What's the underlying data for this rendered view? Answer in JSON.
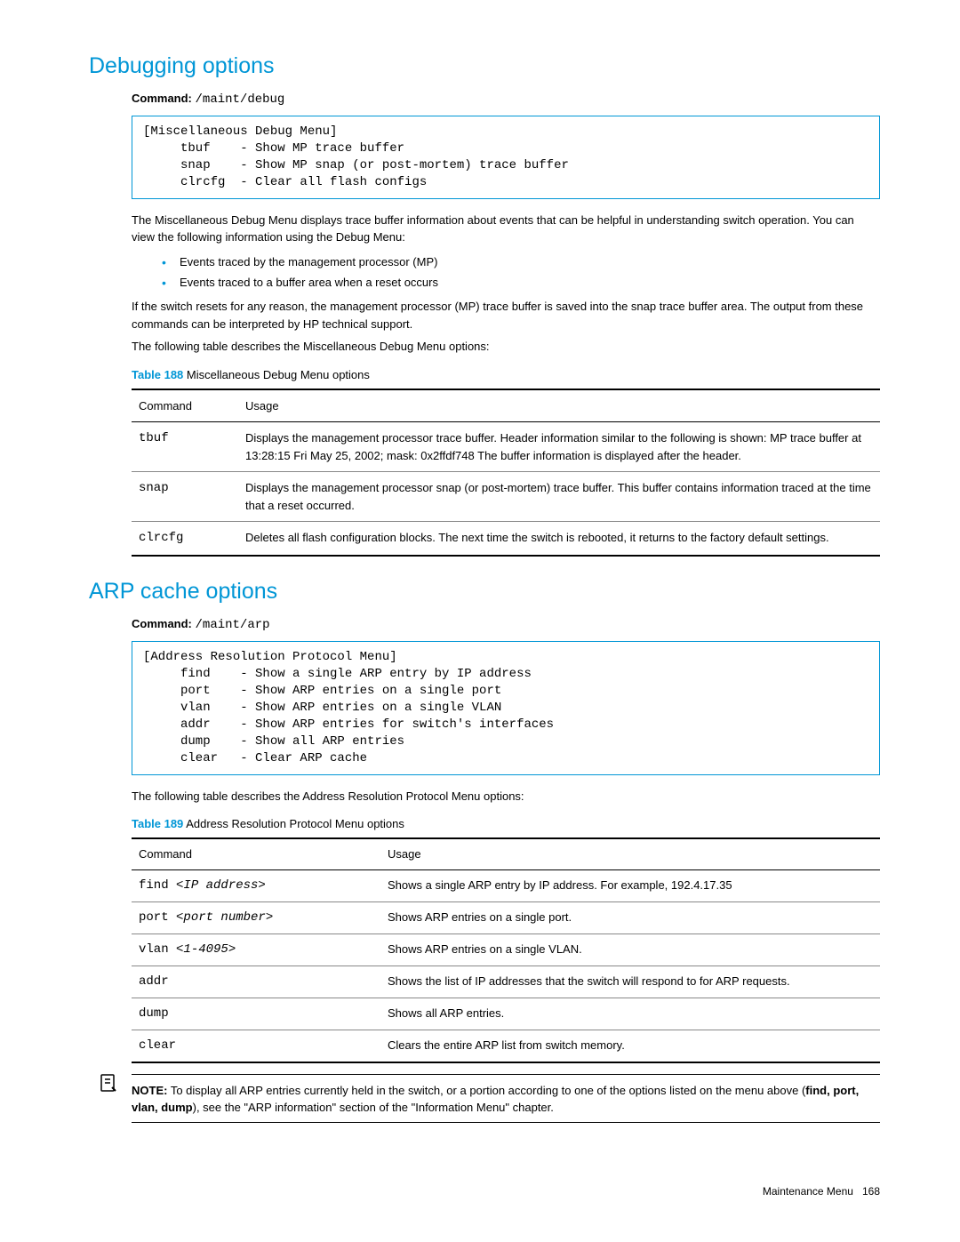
{
  "section1": {
    "heading": "Debugging options",
    "commandLabel": "Command:",
    "commandPath": "/maint/debug",
    "codebox": "[Miscellaneous Debug Menu]\n     tbuf    - Show MP trace buffer\n     snap    - Show MP snap (or post-mortem) trace buffer\n     clrcfg  - Clear all flash configs",
    "para1": "The Miscellaneous Debug Menu displays trace buffer information about events that can be helpful in understanding switch operation. You can view the following information using the Debug Menu:",
    "bullets": [
      "Events traced by the management processor (MP)",
      "Events traced to a buffer area when a reset occurs"
    ],
    "para2": "If the switch resets for any reason, the management processor (MP) trace buffer is saved into the snap trace buffer area. The output from these commands can be interpreted by HP technical support.",
    "para3": "The following table describes the Miscellaneous Debug Menu options:",
    "tableLabel": "Table 188",
    "tableTitle": "Miscellaneous Debug Menu options",
    "th1": "Command",
    "th2": "Usage",
    "rows": [
      {
        "cmd": "tbuf",
        "usage": "Displays the management processor trace buffer. Header information similar to the following is shown: MP trace buffer at 13:28:15 Fri May 25, 2002; mask: 0x2ffdf748\nThe buffer information is displayed after the header."
      },
      {
        "cmd": "snap",
        "usage": "Displays the management processor snap (or post-mortem) trace buffer. This buffer contains information traced at the time that a reset occurred."
      },
      {
        "cmd": "clrcfg",
        "usage": "Deletes all flash configuration blocks. The next time the switch is rebooted, it returns to the factory default settings."
      }
    ]
  },
  "section2": {
    "heading": "ARP cache options",
    "commandLabel": "Command:",
    "commandPath": "/maint/arp",
    "codebox": "[Address Resolution Protocol Menu]\n     find    - Show a single ARP entry by IP address\n     port    - Show ARP entries on a single port\n     vlan    - Show ARP entries on a single VLAN\n     addr    - Show ARP entries for switch's interfaces\n     dump    - Show all ARP entries\n     clear   - Clear ARP cache",
    "para1": "The following table describes the Address Resolution Protocol Menu options:",
    "tableLabel": "Table 189",
    "tableTitle": "Address Resolution Protocol Menu options",
    "th1": "Command",
    "th2": "Usage",
    "rows": [
      {
        "cmdPrefix": "find ",
        "cmdItalic": "<IP address>",
        "usage": "Shows a single ARP entry by IP address. For example, 192.4.17.35"
      },
      {
        "cmdPrefix": "port ",
        "cmdItalic": "<port number>",
        "usage": "Shows ARP entries on a single port."
      },
      {
        "cmdPrefix": "vlan ",
        "cmdItalic": "<1-4095>",
        "usage": "Shows ARP entries on a single VLAN."
      },
      {
        "cmdPrefix": "addr",
        "cmdItalic": "",
        "usage": "Shows the list of IP addresses that the switch will respond to for ARP requests."
      },
      {
        "cmdPrefix": "dump",
        "cmdItalic": "",
        "usage": "Shows all ARP entries."
      },
      {
        "cmdPrefix": "clear",
        "cmdItalic": "",
        "usage": "Clears the entire ARP list from switch memory."
      }
    ]
  },
  "note": {
    "label": "NOTE:",
    "textBefore": "To display all ARP entries currently held in the switch, or a portion according to one of the options listed on the menu above (",
    "bold": "find, port, vlan, dump",
    "textAfter": "), see the \"ARP information\" section of the \"Information Menu\" chapter."
  },
  "footer": {
    "chapter": "Maintenance Menu",
    "page": "168"
  }
}
